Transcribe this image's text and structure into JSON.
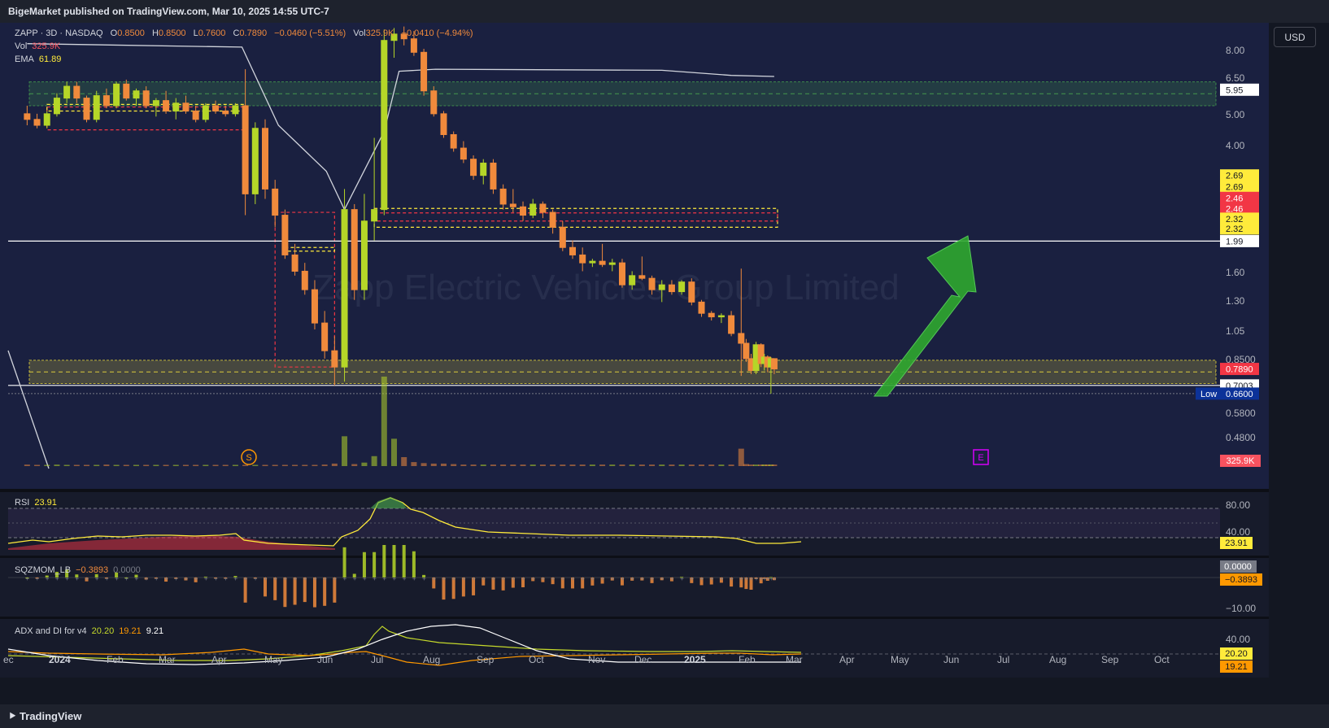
{
  "header": {
    "published": "BigeMarket published on TradingView.com, Mar 10, 2025 14:55 UTC-7"
  },
  "footer": {
    "brand": "TradingView"
  },
  "currency_button": "USD",
  "watermark": "Zapp Electric Vehicles Group Limited",
  "legend": {
    "symbol": "ZAPP · 3D · NASDAQ",
    "ohlc": {
      "o_label": "O",
      "o": "0.8500",
      "h_label": "H",
      "h": "0.8500",
      "l_label": "L",
      "l": "0.7600",
      "c_label": "C",
      "c": "0.7890",
      "change": "−0.0460 (−5.51%)",
      "vol_label": "Vol",
      "vol": "325.9K",
      "vol_change": "−0.0410 (−4.94%)"
    },
    "vol_row": {
      "label": "Vol",
      "value": "325.9K"
    },
    "ema_row": {
      "label": "EMA",
      "value": "61.89"
    }
  },
  "markers": {
    "s": "S",
    "e": "E"
  },
  "price_axis_ticks": [
    "8.00",
    "6.50",
    "5.00",
    "4.00",
    "1.60",
    "1.30",
    "1.05",
    "0.8500",
    "0.5800",
    "0.4800"
  ],
  "price_badges": [
    {
      "label": "5.95",
      "price": 5.95,
      "bg": "#ffffff",
      "fg": "#131722"
    },
    {
      "label": "2.69",
      "price": 3.2,
      "bg": "#ffeb3b",
      "fg": "#131722"
    },
    {
      "label": "2.69",
      "price": 2.95,
      "bg": "#ffeb3b",
      "fg": "#131722"
    },
    {
      "label": "2.46",
      "price": 2.72,
      "bg": "#f23645",
      "fg": "#ffffff"
    },
    {
      "label": "2.46",
      "price": 2.52,
      "bg": "#f23645",
      "fg": "#ffffff"
    },
    {
      "label": "2.32",
      "price": 2.34,
      "bg": "#ffeb3b",
      "fg": "#131722"
    },
    {
      "label": "2.32",
      "price": 2.18,
      "bg": "#ffeb3b",
      "fg": "#131722"
    },
    {
      "label": "1.99",
      "price": 1.99,
      "bg": "#ffffff",
      "fg": "#131722"
    },
    {
      "label": "0.7890",
      "price": 0.789,
      "bg": "#f23645",
      "fg": "#ffffff"
    },
    {
      "label": "0.7003",
      "price": 0.7003,
      "bg": "#ffffff",
      "fg": "#131722"
    },
    {
      "label": "0.6600",
      "price": 0.66,
      "bg": "#0c3299",
      "fg": "#ffffff",
      "prefix": "Low"
    }
  ],
  "volume_badge": "325.9K",
  "time_axis": [
    "ec",
    "2024",
    "Feb",
    "Mar",
    "Apr",
    "May",
    "Jun",
    "Jul",
    "Aug",
    "Sep",
    "Oct",
    "Nov",
    "Dec",
    "2025",
    "Feb",
    "Mar",
    "Apr",
    "May",
    "Jun",
    "Jul",
    "Aug",
    "Sep",
    "Oct"
  ],
  "rsi": {
    "label": "RSI",
    "value": "23.91",
    "ticks": [
      "80.00",
      "40.00"
    ],
    "badge": "23.91"
  },
  "sqz": {
    "label": "SQZMOM_LB",
    "value": "−0.3893",
    "value2": "0.0000",
    "ticks": [
      "−10.00"
    ],
    "badges": [
      "0.0000",
      "−0.3893"
    ]
  },
  "adx": {
    "label": "ADX and DI for v4",
    "v1": "20.20",
    "v2": "19.21",
    "v3": "9.21",
    "ticks": [
      "40.00"
    ],
    "badges": [
      "20.20",
      "19.21"
    ]
  },
  "colors": {
    "bull": "#b5d628",
    "bear": "#f08a3c",
    "zone_green": "#4caf50",
    "zone_yellow": "#ffeb3b",
    "zone_red": "#f23645",
    "arrow": "#2fa82f",
    "ema": "#d1d4dc"
  },
  "chart_data": {
    "type": "candlestick",
    "symbol": "ZAPP",
    "interval": "3D",
    "y_scale": "log",
    "ylim": [
      0.44,
      8.5
    ],
    "candles": [
      {
        "t": "2023-12-12",
        "o": 5.0,
        "h": 5.3,
        "l": 4.6,
        "c": 4.8
      },
      {
        "t": "2023-12-18",
        "o": 4.8,
        "h": 5.0,
        "l": 4.5,
        "c": 4.6
      },
      {
        "t": "2023-12-24",
        "o": 4.6,
        "h": 5.1,
        "l": 4.5,
        "c": 5.0
      },
      {
        "t": "2023-12-30",
        "o": 5.0,
        "h": 5.8,
        "l": 4.9,
        "c": 5.6
      },
      {
        "t": "2024-01-05",
        "o": 5.6,
        "h": 6.3,
        "l": 5.4,
        "c": 6.1
      },
      {
        "t": "2024-01-11",
        "o": 6.1,
        "h": 6.3,
        "l": 5.4,
        "c": 5.6
      },
      {
        "t": "2024-01-17",
        "o": 5.6,
        "h": 5.7,
        "l": 4.7,
        "c": 4.8
      },
      {
        "t": "2024-01-23",
        "o": 4.8,
        "h": 5.9,
        "l": 4.7,
        "c": 5.7
      },
      {
        "t": "2024-01-29",
        "o": 5.7,
        "h": 6.0,
        "l": 5.2,
        "c": 5.3
      },
      {
        "t": "2024-02-04",
        "o": 5.3,
        "h": 6.3,
        "l": 5.2,
        "c": 6.2
      },
      {
        "t": "2024-02-10",
        "o": 6.2,
        "h": 6.4,
        "l": 5.5,
        "c": 5.6
      },
      {
        "t": "2024-02-16",
        "o": 5.6,
        "h": 6.0,
        "l": 5.3,
        "c": 5.9
      },
      {
        "t": "2024-02-22",
        "o": 5.9,
        "h": 6.1,
        "l": 5.2,
        "c": 5.3
      },
      {
        "t": "2024-02-28",
        "o": 5.3,
        "h": 5.6,
        "l": 4.9,
        "c": 5.5
      },
      {
        "t": "2024-03-05",
        "o": 5.5,
        "h": 5.9,
        "l": 5.0,
        "c": 5.1
      },
      {
        "t": "2024-03-11",
        "o": 5.1,
        "h": 5.6,
        "l": 4.8,
        "c": 5.4
      },
      {
        "t": "2024-03-17",
        "o": 5.4,
        "h": 5.7,
        "l": 5.0,
        "c": 5.1
      },
      {
        "t": "2024-03-23",
        "o": 5.1,
        "h": 5.3,
        "l": 4.7,
        "c": 4.8
      },
      {
        "t": "2024-03-29",
        "o": 4.8,
        "h": 5.4,
        "l": 4.7,
        "c": 5.3
      },
      {
        "t": "2024-04-04",
        "o": 5.3,
        "h": 5.5,
        "l": 5.0,
        "c": 5.1
      },
      {
        "t": "2024-04-10",
        "o": 5.1,
        "h": 5.3,
        "l": 4.9,
        "c": 5.0
      },
      {
        "t": "2024-04-16",
        "o": 5.0,
        "h": 5.4,
        "l": 4.9,
        "c": 5.3
      },
      {
        "t": "2024-04-22",
        "o": 5.3,
        "h": 6.9,
        "l": 2.4,
        "c": 2.8
      },
      {
        "t": "2024-04-28",
        "o": 2.8,
        "h": 4.7,
        "l": 2.6,
        "c": 4.5
      },
      {
        "t": "2024-05-04",
        "o": 4.5,
        "h": 4.8,
        "l": 2.7,
        "c": 2.9
      },
      {
        "t": "2024-05-10",
        "o": 2.9,
        "h": 3.1,
        "l": 2.2,
        "c": 2.4
      },
      {
        "t": "2024-05-16",
        "o": 2.4,
        "h": 2.5,
        "l": 1.75,
        "c": 1.8
      },
      {
        "t": "2024-05-22",
        "o": 1.8,
        "h": 1.95,
        "l": 1.55,
        "c": 1.6
      },
      {
        "t": "2024-05-28",
        "o": 1.6,
        "h": 1.7,
        "l": 1.35,
        "c": 1.4
      },
      {
        "t": "2024-06-03",
        "o": 1.4,
        "h": 1.5,
        "l": 1.05,
        "c": 1.1
      },
      {
        "t": "2024-06-09",
        "o": 1.1,
        "h": 1.2,
        "l": 0.85,
        "c": 0.9
      },
      {
        "t": "2024-06-15",
        "o": 0.9,
        "h": 1.0,
        "l": 0.7,
        "c": 0.8
      },
      {
        "t": "2024-06-21",
        "o": 0.8,
        "h": 2.9,
        "l": 0.72,
        "c": 2.5
      },
      {
        "t": "2024-06-27",
        "o": 2.5,
        "h": 2.6,
        "l": 1.3,
        "c": 1.4
      },
      {
        "t": "2024-07-03",
        "o": 1.4,
        "h": 2.8,
        "l": 1.3,
        "c": 2.3
      },
      {
        "t": "2024-07-09",
        "o": 2.3,
        "h": 4.2,
        "l": 2.0,
        "c": 2.5
      },
      {
        "t": "2024-07-15",
        "o": 2.5,
        "h": 9.2,
        "l": 2.4,
        "c": 8.5
      },
      {
        "t": "2024-07-21",
        "o": 8.5,
        "h": 9.3,
        "l": 7.5,
        "c": 8.9
      },
      {
        "t": "2024-07-27",
        "o": 8.9,
        "h": 9.4,
        "l": 8.2,
        "c": 8.6
      },
      {
        "t": "2024-08-02",
        "o": 8.6,
        "h": 9.1,
        "l": 7.6,
        "c": 7.8
      },
      {
        "t": "2024-08-08",
        "o": 7.8,
        "h": 8.0,
        "l": 5.7,
        "c": 5.9
      },
      {
        "t": "2024-08-14",
        "o": 5.9,
        "h": 6.1,
        "l": 4.9,
        "c": 5.0
      },
      {
        "t": "2024-08-20",
        "o": 5.0,
        "h": 5.1,
        "l": 4.2,
        "c": 4.3
      },
      {
        "t": "2024-08-26",
        "o": 4.3,
        "h": 4.4,
        "l": 3.8,
        "c": 3.9
      },
      {
        "t": "2024-09-01",
        "o": 3.9,
        "h": 4.1,
        "l": 3.5,
        "c": 3.6
      },
      {
        "t": "2024-09-07",
        "o": 3.6,
        "h": 3.7,
        "l": 3.1,
        "c": 3.2
      },
      {
        "t": "2024-09-13",
        "o": 3.2,
        "h": 3.6,
        "l": 3.0,
        "c": 3.5
      },
      {
        "t": "2024-09-19",
        "o": 3.5,
        "h": 3.6,
        "l": 2.8,
        "c": 2.9
      },
      {
        "t": "2024-09-25",
        "o": 2.9,
        "h": 3.0,
        "l": 2.5,
        "c": 2.6
      },
      {
        "t": "2024-10-01",
        "o": 2.6,
        "h": 2.9,
        "l": 2.45,
        "c": 2.55
      },
      {
        "t": "2024-10-07",
        "o": 2.55,
        "h": 2.65,
        "l": 2.3,
        "c": 2.4
      },
      {
        "t": "2024-10-13",
        "o": 2.4,
        "h": 2.7,
        "l": 2.35,
        "c": 2.6
      },
      {
        "t": "2024-10-19",
        "o": 2.6,
        "h": 2.65,
        "l": 2.35,
        "c": 2.45
      },
      {
        "t": "2024-10-25",
        "o": 2.45,
        "h": 2.5,
        "l": 2.1,
        "c": 2.2
      },
      {
        "t": "2024-10-31",
        "o": 2.2,
        "h": 2.3,
        "l": 1.85,
        "c": 1.9
      },
      {
        "t": "2024-11-06",
        "o": 1.9,
        "h": 2.0,
        "l": 1.75,
        "c": 1.8
      },
      {
        "t": "2024-11-12",
        "o": 1.8,
        "h": 1.9,
        "l": 1.6,
        "c": 1.7
      },
      {
        "t": "2024-11-18",
        "o": 1.7,
        "h": 1.75,
        "l": 1.65,
        "c": 1.72
      },
      {
        "t": "2024-11-24",
        "o": 1.72,
        "h": 1.95,
        "l": 1.65,
        "c": 1.68
      },
      {
        "t": "2024-11-30",
        "o": 1.68,
        "h": 1.75,
        "l": 1.6,
        "c": 1.7
      },
      {
        "t": "2024-12-06",
        "o": 1.7,
        "h": 1.75,
        "l": 1.42,
        "c": 1.45
      },
      {
        "t": "2024-12-12",
        "o": 1.45,
        "h": 1.6,
        "l": 1.4,
        "c": 1.55
      },
      {
        "t": "2024-12-18",
        "o": 1.55,
        "h": 1.78,
        "l": 1.5,
        "c": 1.52
      },
      {
        "t": "2024-12-24",
        "o": 1.52,
        "h": 1.55,
        "l": 1.35,
        "c": 1.4
      },
      {
        "t": "2024-12-30",
        "o": 1.4,
        "h": 1.5,
        "l": 1.28,
        "c": 1.45
      },
      {
        "t": "2025-01-05",
        "o": 1.45,
        "h": 1.5,
        "l": 1.35,
        "c": 1.38
      },
      {
        "t": "2025-01-11",
        "o": 1.38,
        "h": 1.5,
        "l": 1.35,
        "c": 1.48
      },
      {
        "t": "2025-01-17",
        "o": 1.48,
        "h": 1.52,
        "l": 1.25,
        "c": 1.28
      },
      {
        "t": "2025-01-23",
        "o": 1.28,
        "h": 1.3,
        "l": 1.15,
        "c": 1.18
      },
      {
        "t": "2025-01-29",
        "o": 1.18,
        "h": 1.2,
        "l": 1.12,
        "c": 1.15
      },
      {
        "t": "2025-02-04",
        "o": 1.15,
        "h": 1.18,
        "l": 1.1,
        "c": 1.16
      },
      {
        "t": "2025-02-10",
        "o": 1.16,
        "h": 1.2,
        "l": 1.0,
        "c": 1.02
      },
      {
        "t": "2025-02-16",
        "o": 1.02,
        "h": 1.63,
        "l": 0.75,
        "c": 0.95
      },
      {
        "t": "2025-02-19",
        "o": 0.95,
        "h": 0.98,
        "l": 0.83,
        "c": 0.85
      },
      {
        "t": "2025-02-22",
        "o": 0.85,
        "h": 0.88,
        "l": 0.76,
        "c": 0.78
      },
      {
        "t": "2025-02-25",
        "o": 0.78,
        "h": 0.96,
        "l": 0.76,
        "c": 0.94
      },
      {
        "t": "2025-02-28",
        "o": 0.94,
        "h": 0.95,
        "l": 0.8,
        "c": 0.82
      },
      {
        "t": "2025-03-02",
        "o": 0.82,
        "h": 0.88,
        "l": 0.78,
        "c": 0.86
      },
      {
        "t": "2025-03-04",
        "o": 0.86,
        "h": 0.87,
        "l": 0.77,
        "c": 0.8
      },
      {
        "t": "2025-03-06",
        "o": 0.8,
        "h": 0.86,
        "l": 0.66,
        "c": 0.85
      },
      {
        "t": "2025-03-08",
        "o": 0.85,
        "h": 0.85,
        "l": 0.76,
        "c": 0.789
      }
    ],
    "volume_k": [
      3,
      2,
      2,
      3,
      2,
      2,
      2,
      2,
      3,
      2,
      2,
      2,
      2,
      2,
      2,
      2,
      2,
      2,
      2,
      2,
      2,
      2,
      2,
      2,
      2,
      2,
      2,
      2,
      2,
      2,
      3,
      5,
      60,
      4,
      7,
      20,
      180,
      55,
      18,
      8,
      6,
      5,
      5,
      4,
      3,
      3,
      3,
      3,
      3,
      3,
      3,
      3,
      3,
      3,
      3,
      3,
      3,
      3,
      3,
      3,
      3,
      3,
      3,
      3,
      3,
      3,
      3,
      3,
      3,
      3,
      3,
      3,
      35,
      4,
      3,
      3,
      3,
      3,
      3,
      3,
      3,
      4
    ],
    "ema": [
      {
        "t": "2023-12-12",
        "v": 8.3
      },
      {
        "t": "2024-04-20",
        "v": 8.1
      },
      {
        "t": "2024-05-12",
        "v": 4.6
      },
      {
        "t": "2024-06-10",
        "v": 3.3
      },
      {
        "t": "2024-06-21",
        "v": 2.5
      },
      {
        "t": "2024-07-15",
        "v": 4.4
      },
      {
        "t": "2024-07-24",
        "v": 6.8
      },
      {
        "t": "2024-08-15",
        "v": 6.9
      },
      {
        "t": "2024-12-30",
        "v": 6.85
      },
      {
        "t": "2025-02-10",
        "v": 6.6
      },
      {
        "t": "2025-03-08",
        "v": 6.55
      }
    ],
    "horizontal_lines": [
      1.99,
      0.7003
    ],
    "zones": [
      {
        "name": "green-supply-zone",
        "from": 5.3,
        "to": 6.3,
        "color": "#4caf50"
      },
      {
        "name": "yellow-demand-zone",
        "from": 0.71,
        "to": 0.84,
        "color": "#ffeb3b"
      }
    ]
  }
}
